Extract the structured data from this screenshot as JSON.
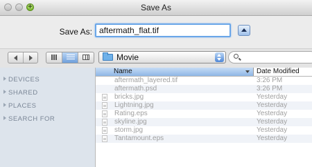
{
  "window": {
    "title": "Save As"
  },
  "save": {
    "label": "Save As:",
    "filename": "aftermath_flat.tif"
  },
  "location": {
    "folder": "Movie"
  },
  "sidebar": {
    "sections": [
      "DEVICES",
      "SHARED",
      "PLACES",
      "SEARCH FOR"
    ]
  },
  "columns": {
    "name": "Name",
    "date": "Date Modified"
  },
  "files": [
    {
      "name": "aftermath_layered.tif",
      "date": "3:26 PM"
    },
    {
      "name": "aftermath.psd",
      "date": "3:26 PM"
    },
    {
      "name": "bricks.jpg",
      "date": "Yesterday"
    },
    {
      "name": "Lightning.jpg",
      "date": "Yesterday"
    },
    {
      "name": "Rating.eps",
      "date": "Yesterday"
    },
    {
      "name": "skyline.jpg",
      "date": "Yesterday"
    },
    {
      "name": "storm.jpg",
      "date": "Yesterday"
    },
    {
      "name": "Tantamount.eps",
      "date": "Yesterday"
    }
  ],
  "colors": {
    "accent": "#6aa6e8",
    "sidebar": "#dde4ec",
    "zoom_button": "#75b62b"
  }
}
